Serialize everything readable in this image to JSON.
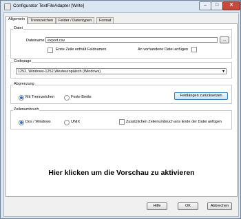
{
  "window": {
    "title": "Configurator TextFileAdapter  [Write]",
    "minimize_glyph": "–",
    "maximize_glyph": "□",
    "close_glyph": "✕"
  },
  "tabs": [
    "Allgemein",
    "Trennzeichen",
    "Felder / Datentypen",
    "Format"
  ],
  "datei": {
    "group_label": "Datei",
    "filename_label": "Dateiname",
    "filename_value": "export.csv",
    "browse_label": "...",
    "first_row_label": "Erste Zeile enthält Feldnamen",
    "append_label": "An vorhandene Datei anfügen"
  },
  "codepage": {
    "group_label": "Codepage",
    "value": "1252, Windows-1252,Westeuropäisch (Windows)",
    "arrow": "▾"
  },
  "abgrenzung": {
    "group_label": "Abgrenzung",
    "option_delim": "Mit Trennzeichen",
    "option_fixed": "Feste Breite",
    "reset_label": "Feldlängen zurücksetzen"
  },
  "zeilenumbruch": {
    "group_label": "Zeilenumbruch",
    "option_dos": "Dos / Windows",
    "option_unix": "UNIX",
    "extra_label": "Zusätzlichen Zeilenumbruch ans Ende der Datei anfügen"
  },
  "preview_text": "Hier klicken um die Vorschau zu aktivieren",
  "footer": {
    "help": "Hilfe",
    "ok": "OK",
    "cancel": "Abbrechen"
  }
}
